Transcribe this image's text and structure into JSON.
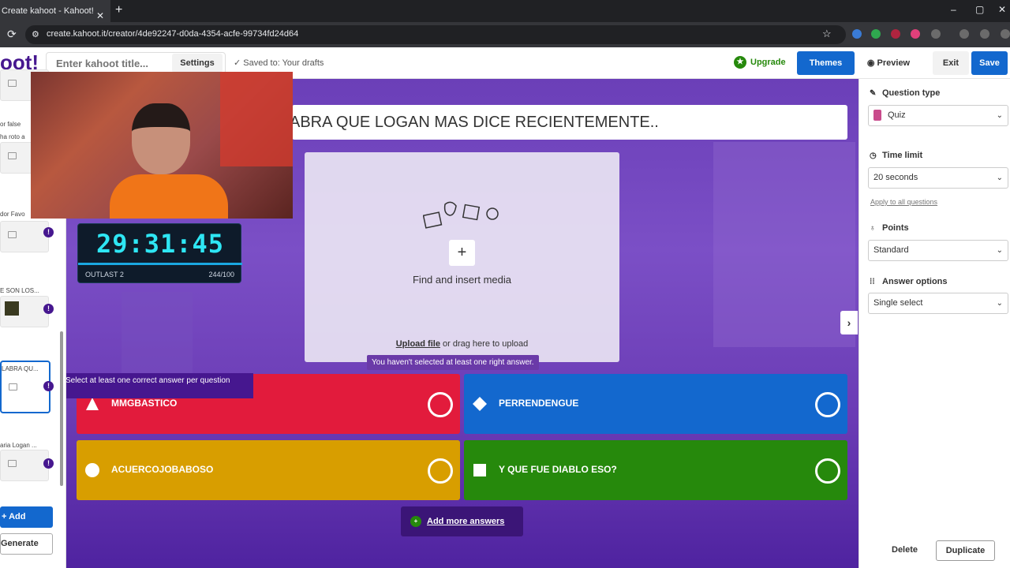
{
  "browser": {
    "tab_title": "Create kahoot - Kahoot!",
    "tab_close": "✕",
    "new_tab": "+",
    "url": "create.kahoot.it/creator/4de92247-d0da-4354-acfe-99734fd24d64",
    "win_min": "–",
    "win_max": "▢",
    "win_close": "✕"
  },
  "header": {
    "logo": "oot!",
    "title_placeholder": "Enter kahoot title...",
    "settings": "Settings",
    "saved": "✓  Saved to: Your drafts",
    "upgrade": "Upgrade",
    "themes": "Themes",
    "preview": "Preview",
    "exit": "Exit",
    "save": "Save"
  },
  "sidebar": {
    "items": [
      {
        "label": "or false"
      },
      {
        "label": "ha roto a"
      },
      {
        "label": "dor Favo"
      },
      {
        "label": "E SON LOS..."
      },
      {
        "label": "LABRA QU..."
      },
      {
        "label": "aria Logan ..."
      }
    ],
    "alert": "!",
    "add": "+ Add",
    "generate": "Generate"
  },
  "canvas": {
    "question": "ABRA QUE LOGAN MAS DICE RECIENTEMENTE..",
    "media_plus": "+",
    "media_find": "Find and insert media",
    "media_upload_link": "Upload file",
    "media_upload_rest": " or drag here to upload",
    "warning": "You haven't selected at least one right answer.",
    "left_tip": "Select at least one correct answer per question",
    "answers": [
      {
        "text": "MMGBASTICO",
        "color": "#e21b3c",
        "shape": "triangle"
      },
      {
        "text": "PERRENDENGUE",
        "color": "#1368ce",
        "shape": "diamond"
      },
      {
        "text": "ACUERCOJOBABOSO",
        "color": "#d89e00",
        "shape": "circle"
      },
      {
        "text": "Y QUE FUE DIABLO ESO?",
        "color": "#26890c",
        "shape": "square"
      }
    ],
    "add_more": "Add more answers",
    "next": "›"
  },
  "overlay": {
    "timer": "29:31:45",
    "game": "OUTLAST 2",
    "count": "244/100"
  },
  "settings_panel": {
    "question_type_label": "Question type",
    "question_type_value": "Quiz",
    "time_limit_label": "Time limit",
    "time_limit_value": "20 seconds",
    "apply_all": "Apply to all questions",
    "points_label": "Points",
    "points_value": "Standard",
    "answer_options_label": "Answer options",
    "answer_options_value": "Single select",
    "delete": "Delete",
    "duplicate": "Duplicate"
  }
}
